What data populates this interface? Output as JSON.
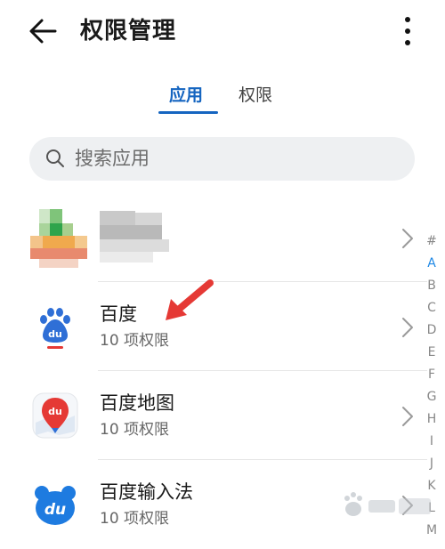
{
  "header": {
    "title": "权限管理",
    "back_icon": "arrow-left-icon",
    "more_icon": "more-vertical-icon"
  },
  "tabs": [
    {
      "label": "应用",
      "active": true
    },
    {
      "label": "权限",
      "active": false
    }
  ],
  "search": {
    "placeholder": "搜索应用",
    "icon": "search-icon"
  },
  "apps": [
    {
      "name": "百度",
      "permissions": "10 项权限",
      "icon": "baidu-paw-icon"
    },
    {
      "name": "百度地图",
      "permissions": "10 项权限",
      "icon": "baidu-map-icon"
    },
    {
      "name": "百度输入法",
      "permissions": "10 项权限",
      "icon": "baidu-input-icon"
    }
  ],
  "index_letters": [
    "#",
    "A",
    "B",
    "C",
    "D",
    "E",
    "F",
    "G",
    "H",
    "I",
    "J",
    "K",
    "L",
    "M"
  ],
  "index_active": "A",
  "colors": {
    "accent": "#1565c0",
    "annotation_arrow": "#e53935",
    "index_active": "#1e88e5"
  }
}
